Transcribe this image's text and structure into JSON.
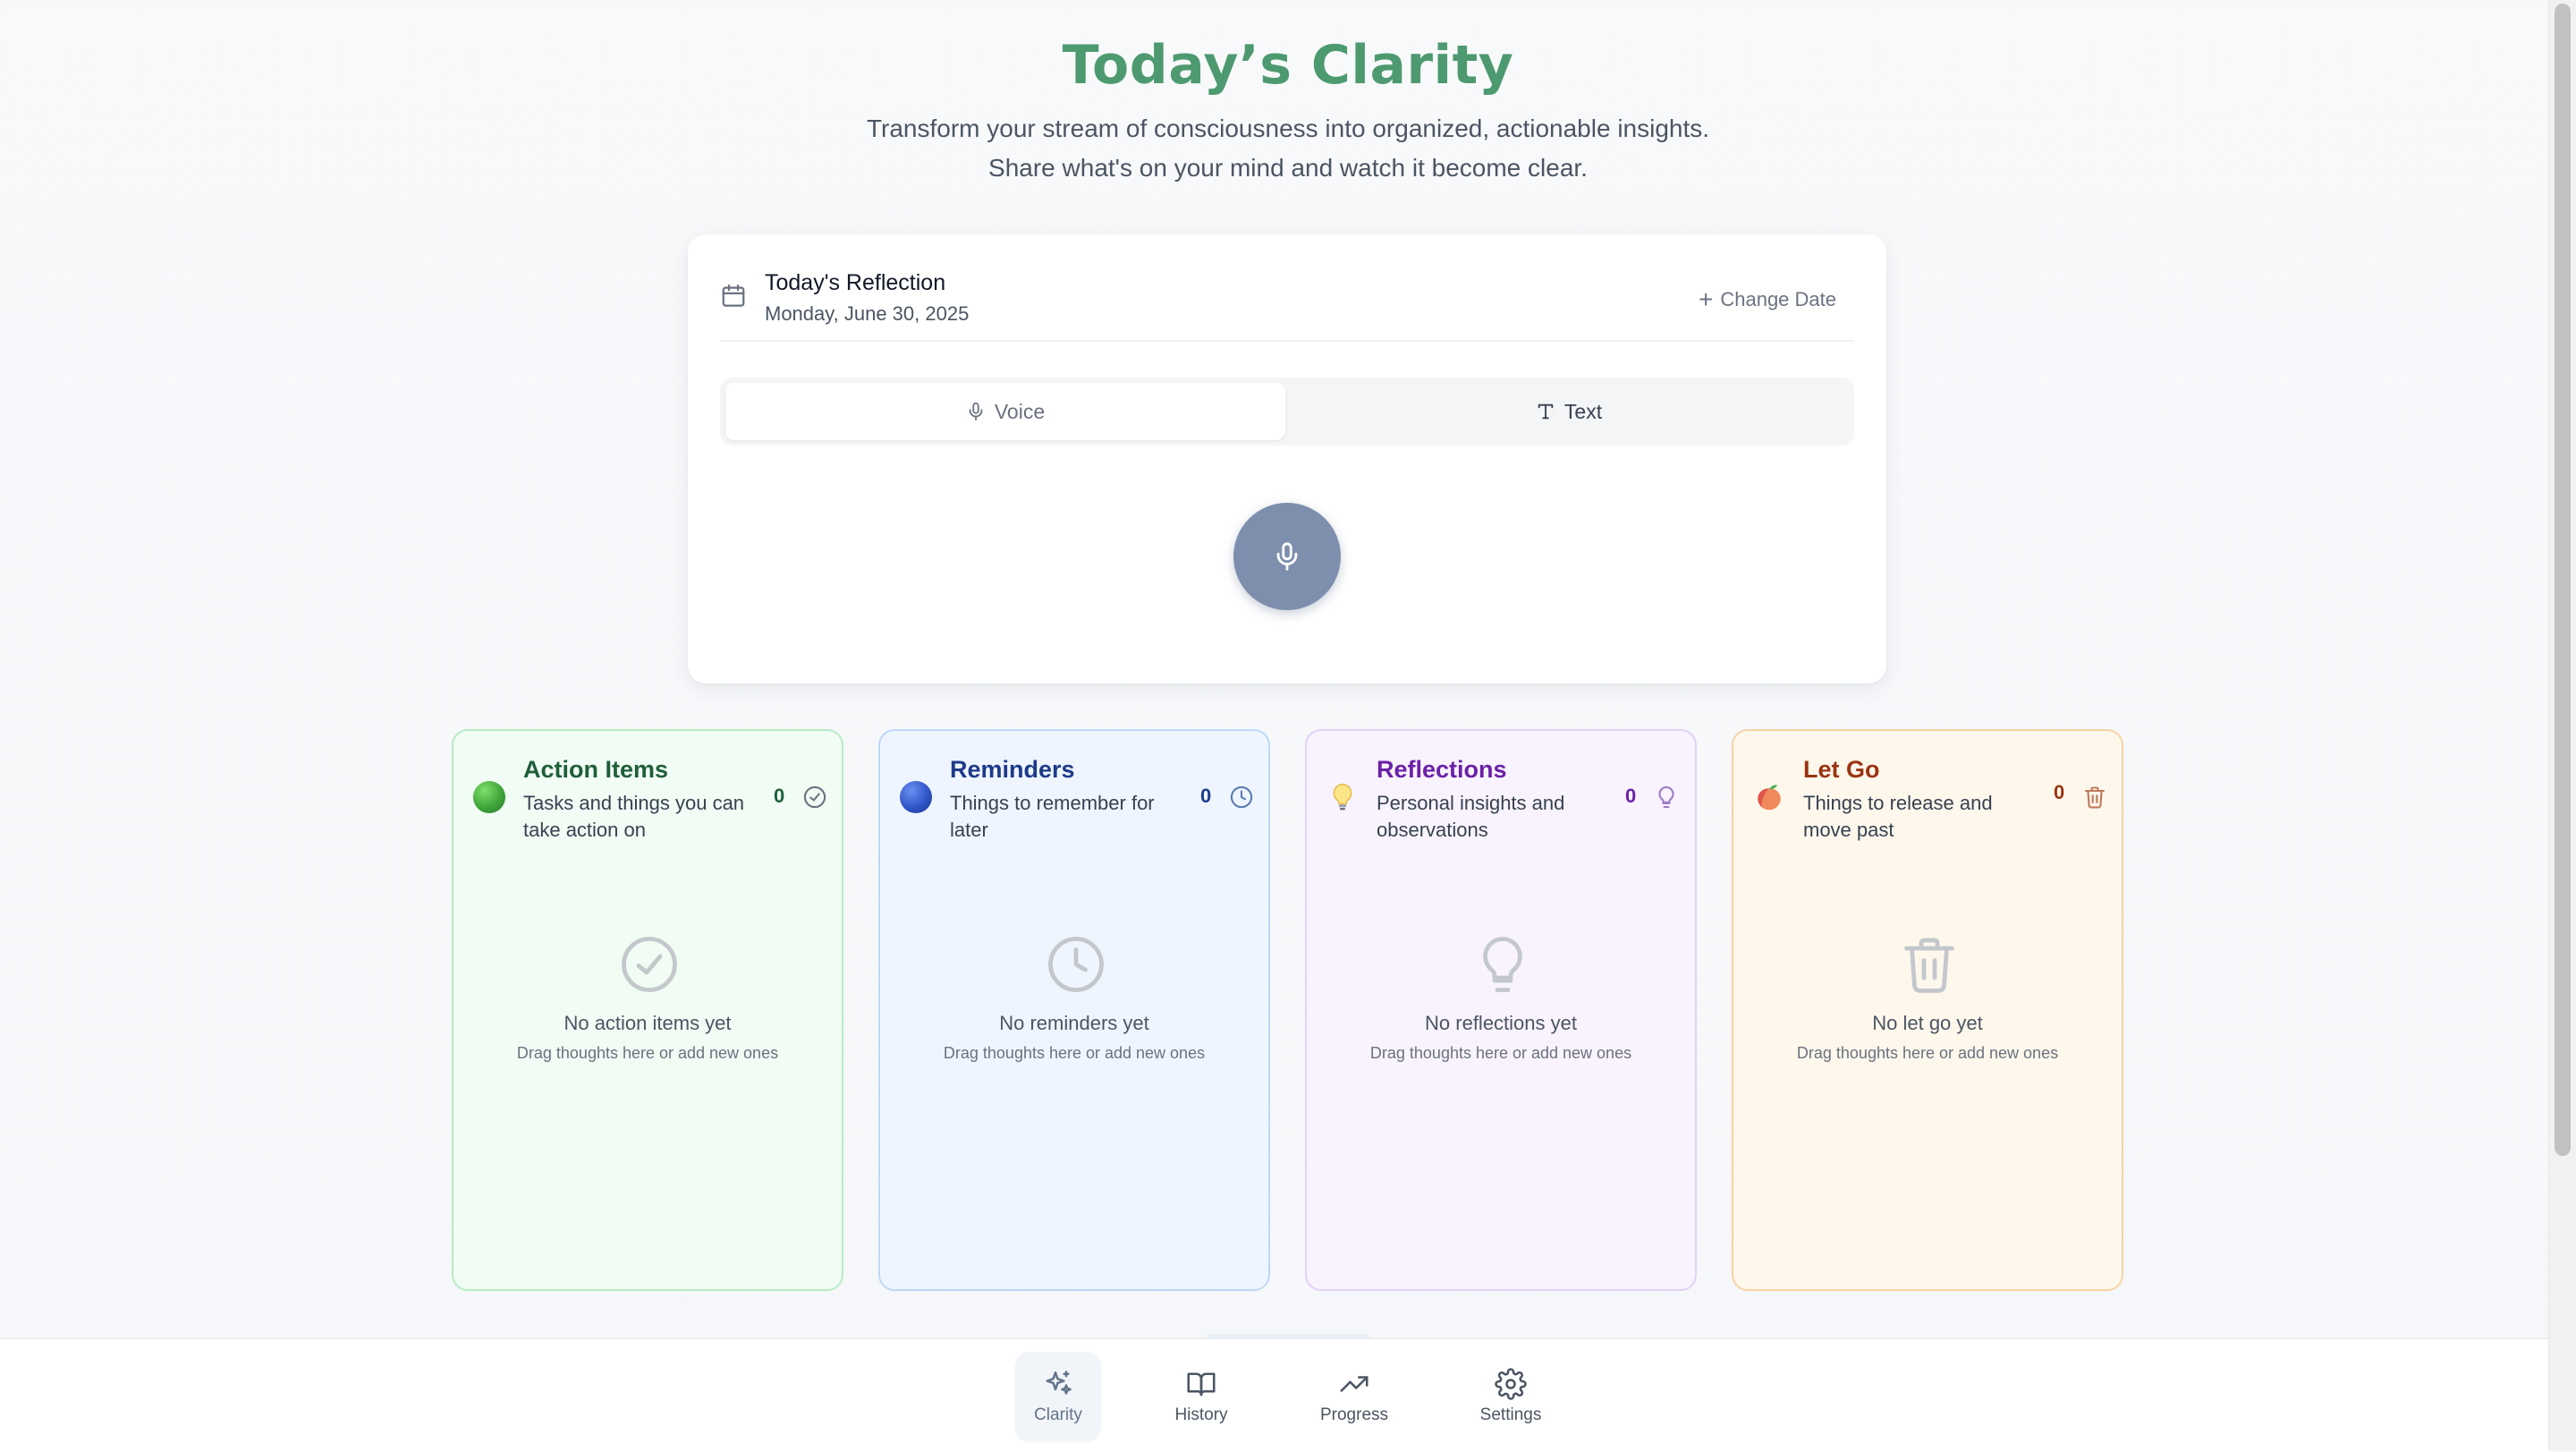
{
  "header": {
    "title": "Today’s Clarity",
    "subtitle_line1": "Transform your stream of consciousness into organized, actionable insights.",
    "subtitle_line2": "Share what's on your mind and watch it become clear."
  },
  "recorder": {
    "title": "Today's Reflection",
    "date": "Monday, June 30, 2025",
    "change_date_label": "Change Date",
    "modes": [
      {
        "label": "Voice",
        "icon": "mic-icon",
        "active": true
      },
      {
        "label": "Text",
        "icon": "text-icon",
        "active": false
      }
    ],
    "record_button_icon": "mic-icon"
  },
  "cards": [
    {
      "title": "Action Items",
      "description": "Tasks and things you can take action on",
      "count": "0",
      "empty_title": "No action items yet",
      "empty_hint": "Drag thoughts here or add new ones",
      "icon": "check-circle-icon",
      "emoji": "green-circle",
      "accent": "#1f5f3a"
    },
    {
      "title": "Reminders",
      "description": "Things to remember for later",
      "count": "0",
      "empty_title": "No reminders yet",
      "empty_hint": "Drag thoughts here or add new ones",
      "icon": "clock-icon",
      "emoji": "blue-circle",
      "accent": "#1e3a8a"
    },
    {
      "title": "Reflections",
      "description": "Personal insights and observations",
      "count": "0",
      "empty_title": "No reflections yet",
      "empty_hint": "Drag thoughts here or add new ones",
      "icon": "lightbulb-icon",
      "emoji": "light-bulb",
      "accent": "#6b21a8"
    },
    {
      "title": "Let Go",
      "description": "Things to release and move past",
      "count": "0",
      "empty_title": "No let go yet",
      "empty_hint": "Drag thoughts here or add new ones",
      "icon": "trash-icon",
      "emoji": "peach",
      "accent": "#9a3412"
    }
  ],
  "nav": {
    "items": [
      {
        "label": "Clarity",
        "icon": "sparkles-icon",
        "active": true
      },
      {
        "label": "History",
        "icon": "book-icon",
        "active": false
      },
      {
        "label": "Progress",
        "icon": "trending-up-icon",
        "active": false
      },
      {
        "label": "Settings",
        "icon": "gear-icon",
        "active": false
      }
    ]
  }
}
